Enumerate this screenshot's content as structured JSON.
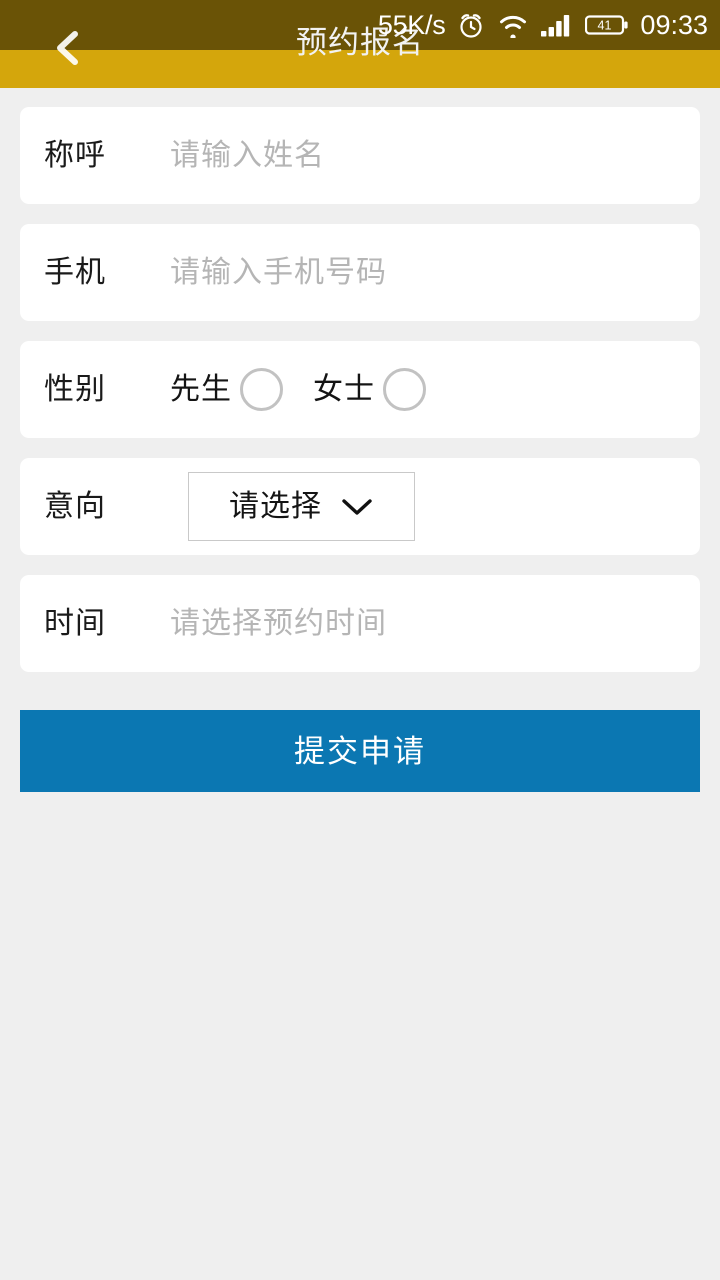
{
  "statusbar": {
    "network_speed": "55K/s",
    "alarm_icon": "alarm-clock-icon",
    "wifi_icon": "wifi-icon",
    "signal_icon": "cellular-signal-icon",
    "battery_level": "41",
    "time": "09:33"
  },
  "header": {
    "title": "预约报名",
    "back_icon": "chevron-left-icon",
    "bg_color": "#d4a60c",
    "scrim_color": "rgba(0,0,0,0.5)",
    "title_color": "#f2f2f2"
  },
  "form": {
    "rows": [
      {
        "label": "称呼",
        "placeholder": "请输入姓名",
        "type": "text"
      },
      {
        "label": "手机",
        "placeholder": "请输入手机号码",
        "type": "tel"
      },
      {
        "label": "性别",
        "type": "radio",
        "options": [
          {
            "text": "先生",
            "selected": false
          },
          {
            "text": "女士",
            "selected": false
          }
        ]
      },
      {
        "label": "意向",
        "type": "select",
        "value": "请选择",
        "chevron_icon": "chevron-down-icon"
      },
      {
        "label": "时间",
        "placeholder": "请选择预约时间",
        "type": "datetime"
      }
    ]
  },
  "submit": {
    "label": "提交申请",
    "color": "#0b77b2"
  },
  "page": {
    "background": "#efefef",
    "card_background": "#ffffff"
  }
}
